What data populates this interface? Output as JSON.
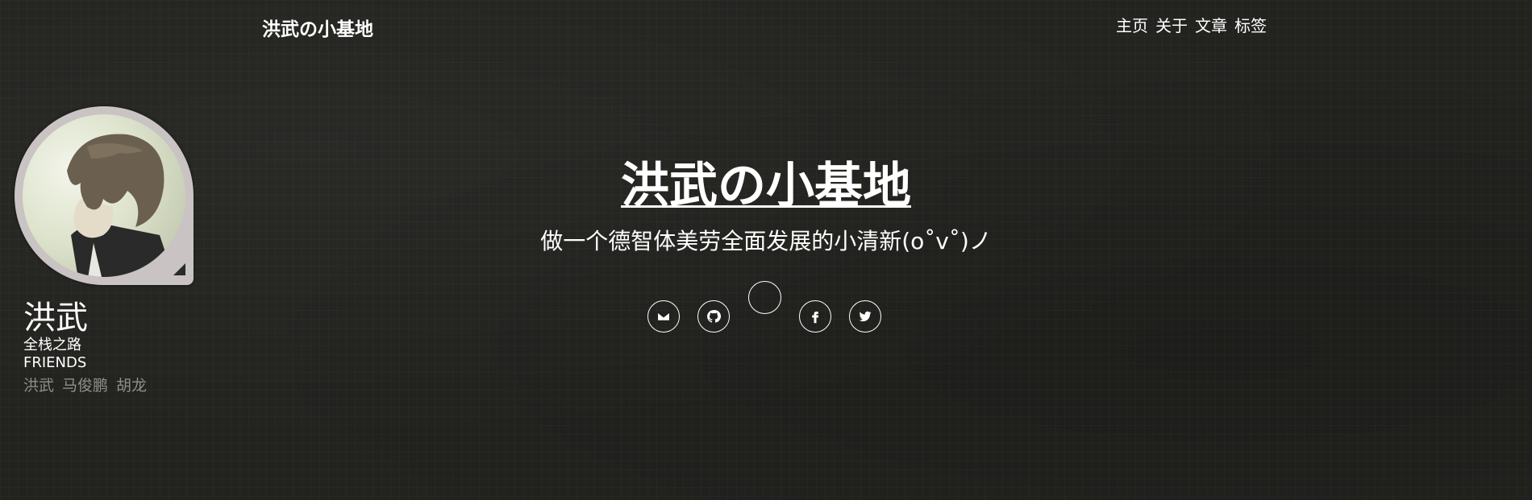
{
  "navbar": {
    "brand": "洪武の小基地",
    "links": [
      "主页",
      "关于",
      "文章",
      "标签"
    ]
  },
  "sidebar": {
    "name": "洪武",
    "description": "全栈之路",
    "friends_title": "FRIENDS",
    "friends": [
      "洪武",
      "马俊鹏",
      "胡龙"
    ]
  },
  "hero": {
    "title": "洪武の小基地",
    "subtitle": "做一个德智体美劳全面发展的小清新(o˚v˚)ノ"
  },
  "social": {
    "icons": [
      "envelope-icon",
      "github-icon",
      "facebook-icon",
      "twitter-icon"
    ]
  },
  "colors": {
    "background": "#22221f",
    "text": "#ffffff",
    "friend_link": "#8e8e8e",
    "avatar_border": "#c9c3c3"
  }
}
